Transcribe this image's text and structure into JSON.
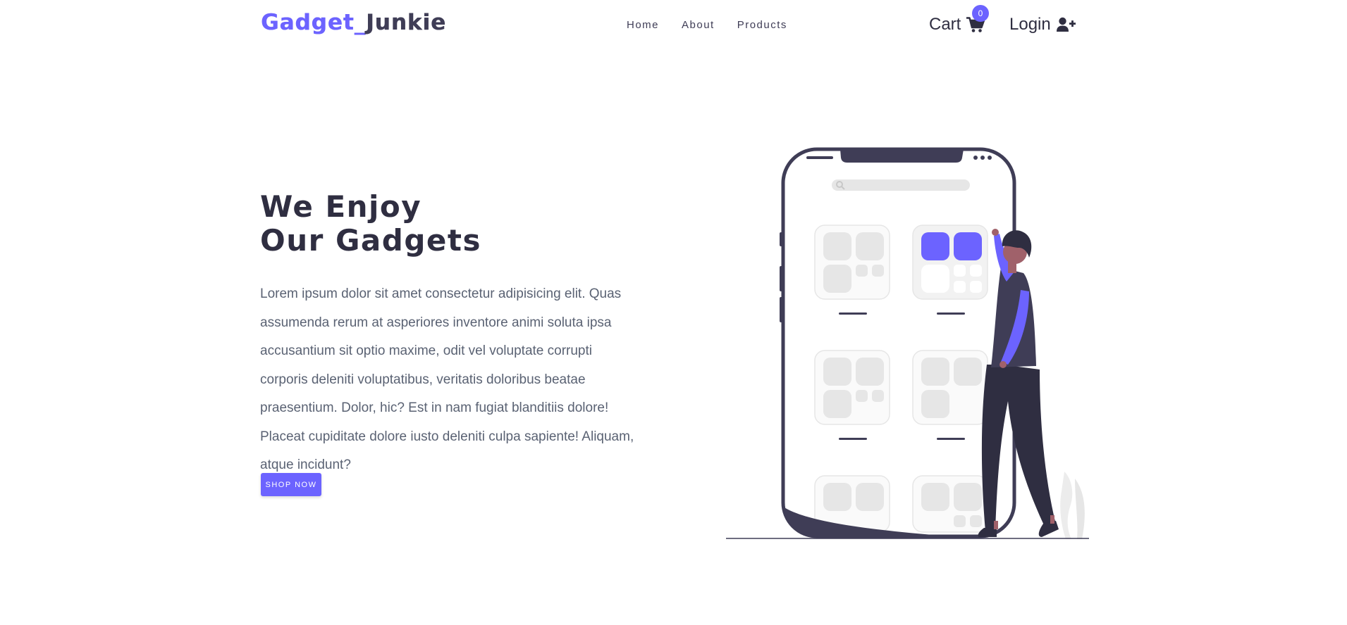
{
  "brand": {
    "part1": "Gadget_",
    "part2": "Junkie"
  },
  "nav": {
    "home": "Home",
    "about": "About",
    "products": "Products"
  },
  "cart": {
    "label": "Cart",
    "icon": "shopping-cart-icon",
    "count": "0"
  },
  "login": {
    "label": "Login",
    "icon": "user-plus-icon"
  },
  "hero": {
    "title_line1": "We Enjoy",
    "title_line2": "Our Gadgets",
    "text": "Lorem ipsum dolor sit amet consectetur adipisicing elit. Quas assumenda rerum at asperiores inventore animi soluta ipsa accusantium sit optio maxime, odit vel voluptate corrupti corporis deleniti voluptatibus, veritatis doloribus beatae praesentium. Dolor, hic? Est in nam fugiat blanditiis dolore! Placeat cupiditate dolore iusto deleniti culpa sapiente! Aliquam, atque incidunt?",
    "button": "SHOP NOW"
  },
  "colors": {
    "accent": "#6c63ff",
    "dark": "#3f3d56",
    "text": "#5a6273"
  }
}
